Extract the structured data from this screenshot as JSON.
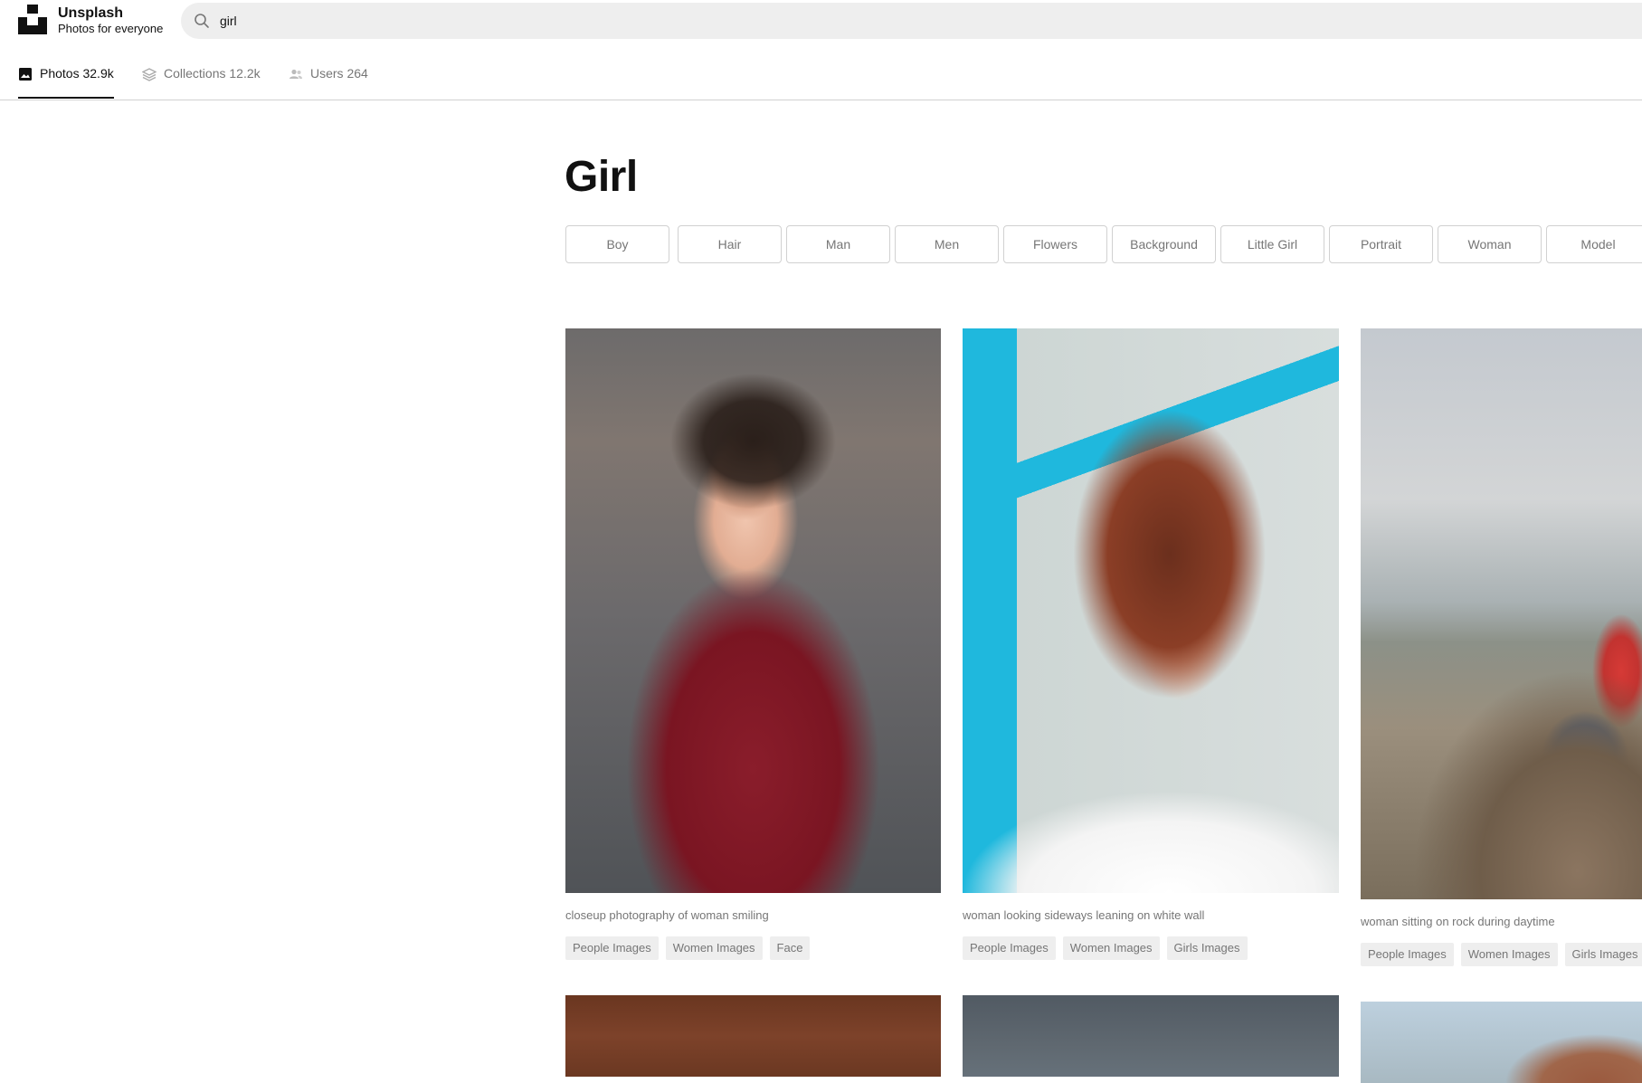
{
  "header": {
    "brand_name": "Unsplash",
    "brand_tagline": "Photos for everyone",
    "search_value": "girl",
    "logo_icon": "unsplash-logo",
    "search_icon": "search-icon"
  },
  "tabs": [
    {
      "label": "Photos 32.9k",
      "icon": "image-icon",
      "active": true
    },
    {
      "label": "Collections 12.2k",
      "icon": "stack-icon",
      "active": false
    },
    {
      "label": "Users 264",
      "icon": "users-icon",
      "active": false
    }
  ],
  "main": {
    "title": "Girl",
    "related_searches": [
      "Boy",
      "Hair",
      "Man",
      "Men",
      "Flowers",
      "Background",
      "Little Girl",
      "Portrait",
      "Woman",
      "Model"
    ]
  },
  "photos": [
    {
      "caption": "closeup photography of woman smiling",
      "tags": [
        "People Images",
        "Women Images",
        "Face"
      ]
    },
    {
      "caption": "woman looking sideways leaning on white wall",
      "tags": [
        "People Images",
        "Women Images",
        "Girls Images"
      ]
    },
    {
      "caption": "woman sitting on rock during daytime",
      "tags": [
        "People Images",
        "Women Images",
        "Girls Images"
      ]
    }
  ],
  "colors": {
    "accent": "#111111",
    "muted_text": "#767676",
    "search_bg": "#eeeeee",
    "border": "#d1d1d1"
  }
}
